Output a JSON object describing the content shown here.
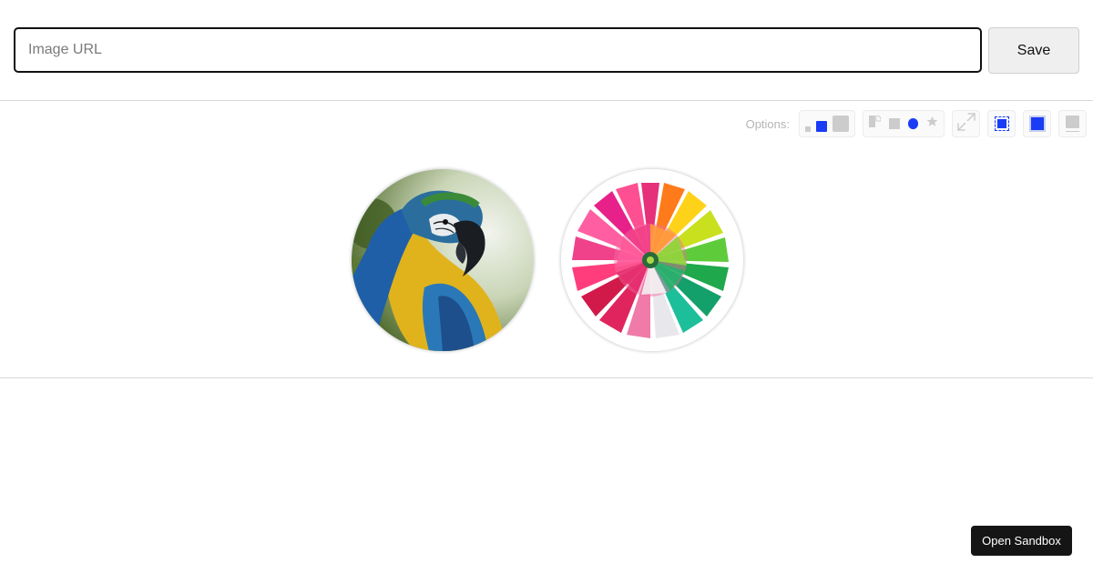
{
  "form": {
    "url_value": "",
    "url_placeholder": "Image URL",
    "save_label": "Save"
  },
  "options": {
    "label": "Options:",
    "accent_color": "#1a3cf5",
    "inactive_color": "#cccccc",
    "groups": [
      {
        "name": "size",
        "choices": [
          "small",
          "medium",
          "large"
        ],
        "selected": "medium"
      },
      {
        "name": "shape",
        "choices": [
          "rounded-corner",
          "square",
          "circle",
          "star"
        ],
        "selected": "circle"
      },
      {
        "name": "expand",
        "icon": "expand-arrows-icon"
      },
      {
        "name": "border",
        "icon": "dashed-border-square-icon",
        "active": true
      },
      {
        "name": "shadow",
        "icon": "shadow-square-icon",
        "active": true
      },
      {
        "name": "caption",
        "icon": "caption-square-icon",
        "active": false
      }
    ]
  },
  "gallery": {
    "images": [
      {
        "subject": "blue-and-yellow macaw parrot photo"
      },
      {
        "subject": "rainbow chrysanthemum flower photo"
      }
    ]
  },
  "footer": {
    "sandbox_label": "Open Sandbox"
  }
}
